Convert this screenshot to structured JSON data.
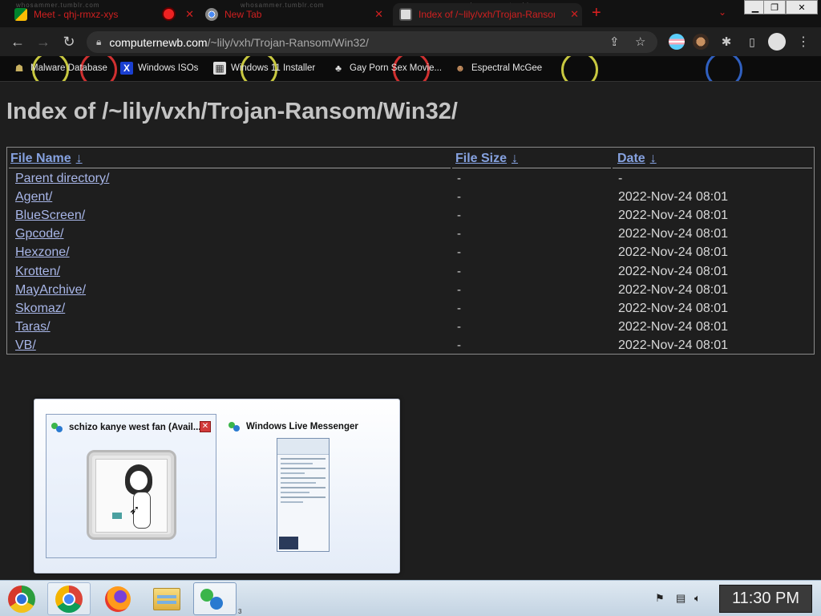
{
  "tabs": [
    {
      "title": "Meet - qhj-rmxz-xys",
      "favicon": "google-meet-icon",
      "recording": true
    },
    {
      "title": "New Tab",
      "favicon": "chrome-icon"
    },
    {
      "title": "Index of /~lily/vxh/Trojan-Ransom",
      "favicon": "computer-icon",
      "active": true
    }
  ],
  "tab_watermark": "whosammer.tumblr.com",
  "toolbar": {
    "url_host": "computernewb.com",
    "url_path": "/~lily/vxh/Trojan-Ransom/Win32/"
  },
  "bookmarks": [
    {
      "label": "Malware Database",
      "icon": "user-icon"
    },
    {
      "label": "Windows ISOs",
      "icon": "x-icon"
    },
    {
      "label": "Windows 11 Installer",
      "icon": "image-icon"
    },
    {
      "label": "Gay Porn Sex Movie...",
      "icon": "figure-icon"
    },
    {
      "label": "Espectral McGee",
      "icon": "person-icon"
    }
  ],
  "page": {
    "title": "Index of /~lily/vxh/Trojan-Ransom/Win32/",
    "headers": {
      "name": "File Name",
      "size": "File Size",
      "date": "Date",
      "sort_arrow": "↓"
    },
    "rows": [
      {
        "name": "Parent directory/",
        "size": "-",
        "date": "-"
      },
      {
        "name": "Agent/",
        "size": "-",
        "date": "2022-Nov-24 08:01"
      },
      {
        "name": "BlueScreen/",
        "size": "-",
        "date": "2022-Nov-24 08:01"
      },
      {
        "name": "Gpcode/",
        "size": "-",
        "date": "2022-Nov-24 08:01"
      },
      {
        "name": "Hexzone/",
        "size": "-",
        "date": "2022-Nov-24 08:01"
      },
      {
        "name": "Krotten/",
        "size": "-",
        "date": "2022-Nov-24 08:01"
      },
      {
        "name": "MayArchive/",
        "size": "-",
        "date": "2022-Nov-24 08:01"
      },
      {
        "name": "Skomaz/",
        "size": "-",
        "date": "2022-Nov-24 08:01"
      },
      {
        "name": "Taras/",
        "size": "-",
        "date": "2022-Nov-24 08:01"
      },
      {
        "name": "VB/",
        "size": "-",
        "date": "2022-Nov-24 08:01"
      }
    ]
  },
  "thumbnails": [
    {
      "title": "schizo kanye west fan (Avail...",
      "selected": true
    },
    {
      "title": "Windows Live Messenger"
    }
  ],
  "taskbar": {
    "clock": "11:30 PM",
    "items": [
      "chromium-icon",
      "chrome-icon",
      "firefox-icon",
      "file-explorer-icon",
      "messenger-icon"
    ],
    "badge": "3"
  },
  "colors": {
    "link": "#a8b6e8",
    "header_link": "#86a2e0",
    "tab_text": "#d02020",
    "page_bg": "#1e1e1e"
  }
}
